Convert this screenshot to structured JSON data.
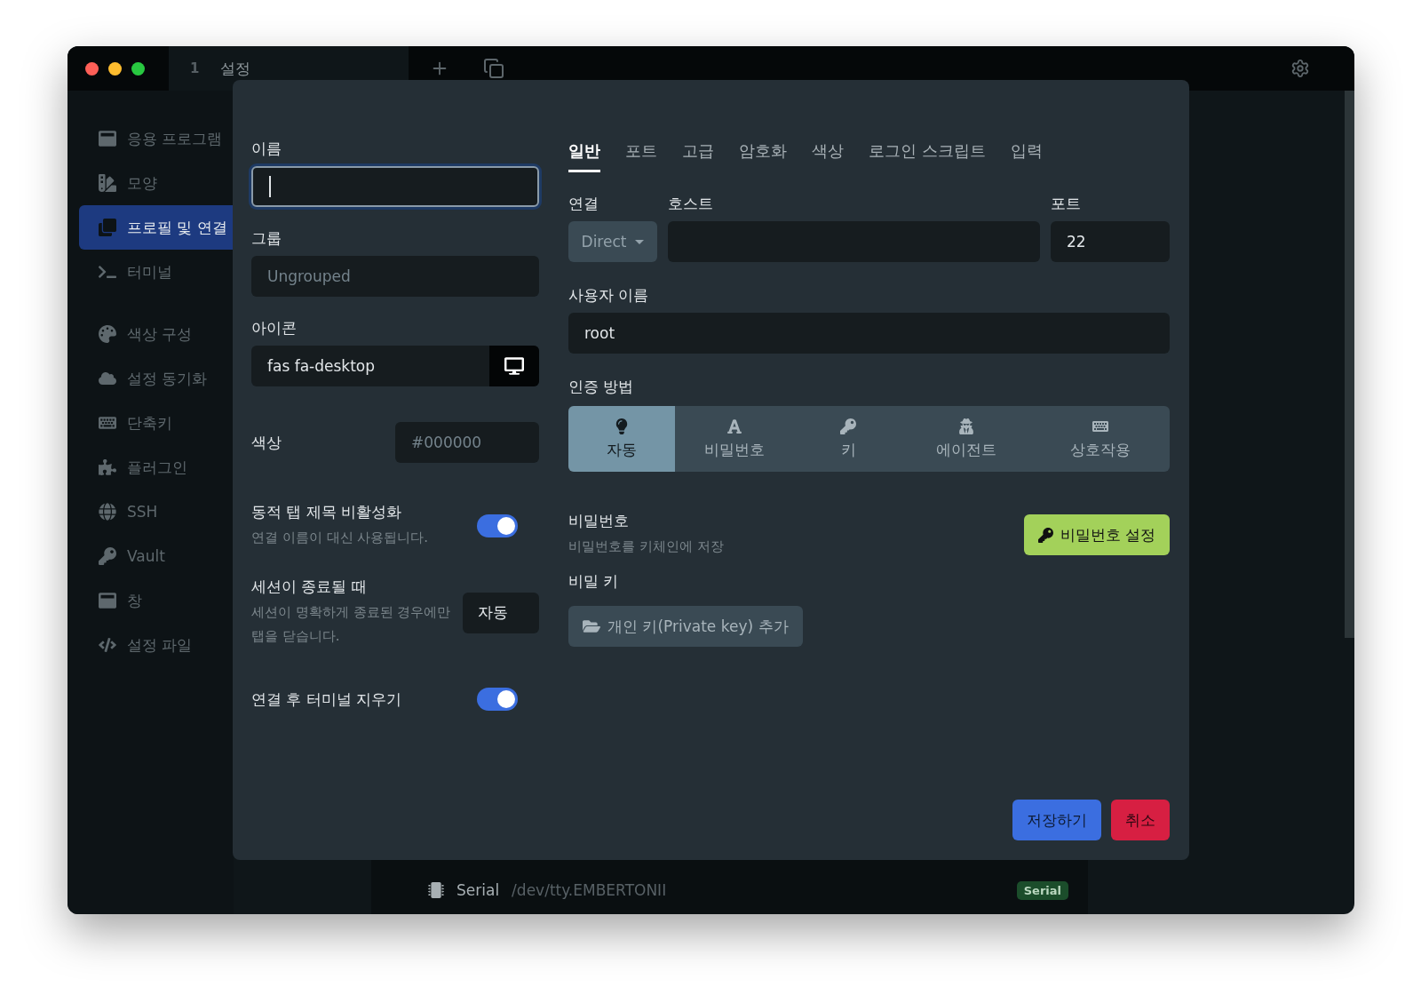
{
  "window": {
    "tab": {
      "number": "1",
      "title": "설정"
    }
  },
  "sidebar": {
    "sections": [
      {
        "items": [
          {
            "label": "응용 프로그램",
            "selected": false
          },
          {
            "label": "모양",
            "selected": false
          },
          {
            "label": "프로필 및 연결",
            "selected": true
          },
          {
            "label": "터미널",
            "selected": false
          }
        ]
      },
      {
        "items": [
          {
            "label": "색상 구성",
            "selected": false
          },
          {
            "label": "설정 동기화",
            "selected": false
          },
          {
            "label": "단축키",
            "selected": false
          },
          {
            "label": "플러그인",
            "selected": false
          },
          {
            "label": "SSH",
            "selected": false
          },
          {
            "label": "Vault",
            "selected": false
          },
          {
            "label": "창",
            "selected": false
          },
          {
            "label": "설정 파일",
            "selected": false
          }
        ]
      }
    ]
  },
  "profile_list": {
    "rows": [
      {
        "name": "Serial",
        "path": "/dev/tty.EMBERTONII",
        "badge": "Serial"
      }
    ]
  },
  "dialog": {
    "name": {
      "label": "이름",
      "focused": true
    },
    "group": {
      "label": "그룹",
      "placeholder": "Ungrouped"
    },
    "icon": {
      "label": "아이콘",
      "value": "fas fa-desktop"
    },
    "color": {
      "label": "색상",
      "placeholder": "#000000"
    },
    "options": [
      {
        "kind": "toggle",
        "label": "동적 탭 제목 비활성화",
        "description": "연결 이름이 대신 사용됩니다.",
        "on": true
      },
      {
        "kind": "select",
        "label": "세션이 종료될 때",
        "description": "세션이 명확하게 종료된 경우에만 탭을 닫습니다.",
        "value": "자동"
      },
      {
        "kind": "toggle",
        "label": "연결 후 터미널 지우기",
        "on": true
      }
    ],
    "tabs": [
      {
        "label": "일반",
        "selected": true
      },
      {
        "label": "포트",
        "selected": false
      },
      {
        "label": "고급",
        "selected": false
      },
      {
        "label": "암호화",
        "selected": false
      },
      {
        "label": "색상",
        "selected": false
      },
      {
        "label": "로그인 스크립트",
        "selected": false
      },
      {
        "label": "입력",
        "selected": false
      }
    ],
    "connection": {
      "label": "연결",
      "value": "Direct"
    },
    "host": {
      "label": "호스트"
    },
    "port": {
      "label": "포트",
      "value": "22"
    },
    "username": {
      "label": "사용자 이름",
      "value": "root"
    },
    "auth": {
      "label": "인증 방법",
      "options": [
        {
          "label": "자동",
          "selected": true
        },
        {
          "label": "비밀번호",
          "selected": false
        },
        {
          "label": "키",
          "selected": false
        },
        {
          "label": "에이전트",
          "selected": false
        },
        {
          "label": "상호작용",
          "selected": false
        }
      ]
    },
    "password": {
      "title": "비밀번호",
      "description": "비밀번호를 키체인에 저장",
      "button": "비밀번호 설정"
    },
    "private_key": {
      "title": "비밀 키",
      "button": "개인 키(Private key) 추가"
    },
    "buttons": [
      {
        "label": "저장하기",
        "kind": "primary"
      },
      {
        "label": "취소",
        "kind": "danger"
      }
    ]
  }
}
